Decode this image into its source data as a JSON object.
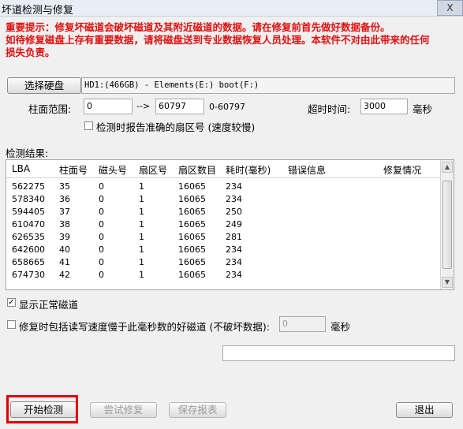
{
  "window": {
    "title": "坏道检测与修复",
    "close_label": "X"
  },
  "warning": {
    "lines": [
      "重要提示：修复坏磁道会破坏磁道及其附近磁道的数据。请在修复前首先做好数据备份。",
      "如待修复磁盘上存有重要数据，请将磁盘送到专业数据恢复人员处理。本软件不对由此带来的任何",
      "损失负责。"
    ]
  },
  "disk": {
    "button_label": "选择硬盘",
    "info": "HD1:(466GB) - Elements(E:) boot(F:)"
  },
  "range": {
    "label": "柱面范围:",
    "from": "0",
    "arrow": "-->",
    "to": "60797",
    "hint": "0-60797"
  },
  "timeout": {
    "label": "超时时间:",
    "value": "3000",
    "unit": "毫秒"
  },
  "report_sector": {
    "label": "检测时报告准确的扇区号 (速度较慢)",
    "checked": false
  },
  "results": {
    "label": "检测结果:",
    "columns": [
      "LBA",
      "柱面号",
      "磁头号",
      "扇区号",
      "扇区数目",
      "耗时(毫秒)",
      "错误信息",
      "修复情况"
    ],
    "rows": [
      [
        "562275",
        "35",
        "0",
        "1",
        "16065",
        "234",
        "",
        ""
      ],
      [
        "578340",
        "36",
        "0",
        "1",
        "16065",
        "234",
        "",
        ""
      ],
      [
        "594405",
        "37",
        "0",
        "1",
        "16065",
        "250",
        "",
        ""
      ],
      [
        "610470",
        "38",
        "0",
        "1",
        "16065",
        "249",
        "",
        ""
      ],
      [
        "626535",
        "39",
        "0",
        "1",
        "16065",
        "281",
        "",
        ""
      ],
      [
        "642600",
        "40",
        "0",
        "1",
        "16065",
        "234",
        "",
        ""
      ],
      [
        "658665",
        "41",
        "0",
        "1",
        "16065",
        "234",
        "",
        ""
      ],
      [
        "674730",
        "42",
        "0",
        "1",
        "16065",
        "234",
        "",
        ""
      ]
    ]
  },
  "show_normal": {
    "label": "显示正常磁道",
    "checked": true
  },
  "repair_slow": {
    "label": "修复时包括读写速度慢于此毫秒数的好磁道 (不破坏数据):",
    "value": "0",
    "unit": "毫秒",
    "checked": false
  },
  "status_text": "",
  "buttons": {
    "start": "开始检测",
    "try_repair": "尝试修复",
    "save_report": "保存报表",
    "exit": "退出"
  },
  "colors": {
    "warning": "#e01010",
    "highlight": "#e00000"
  }
}
